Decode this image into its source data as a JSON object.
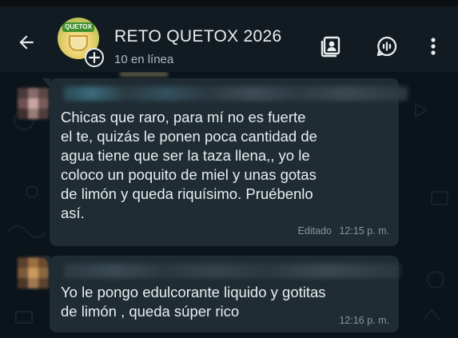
{
  "header": {
    "title": "RETO QUETOX 2026",
    "subtitle": "10 en línea",
    "avatar_logo_text": "QUETOX",
    "back_icon": "arrow-left-icon",
    "add_icon": "plus-icon",
    "action_icons": [
      "contact-card-icon",
      "voice-chat-icon",
      "more-vertical-icon"
    ]
  },
  "messages": [
    {
      "text": "Chicas que raro, para mí no es fuerte\nel te, quizás le ponen poca cantidad de\nagua tiene que ser la taza llena,, yo le\ncoloco un poquito de miel y unas gotas\nde limón y queda riquísimo. Pruébenlo\nasí.",
      "edited_label": "Editado",
      "time": "12:15 p. m."
    },
    {
      "text": "Yo le pongo edulcorante liquido y gotitas\nde limón , queda súper rico",
      "time": "12:16 p. m."
    }
  ],
  "colors": {
    "chat_background": "#0b141a",
    "header_background": "#121b21",
    "bubble_background": "#1f2c33",
    "text_primary": "#e9edef",
    "text_secondary": "#8696a0"
  }
}
